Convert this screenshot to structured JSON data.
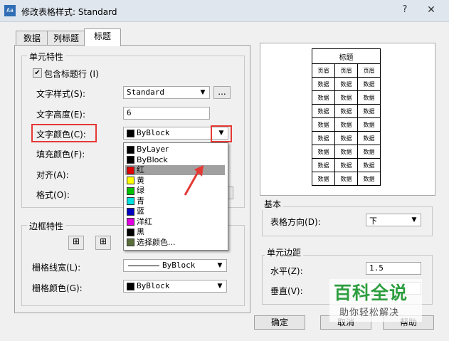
{
  "window": {
    "title": "修改表格样式: Standard",
    "help_glyph": "?",
    "close_glyph": "✕",
    "app_icon": "table-style-icon"
  },
  "tabs": [
    "数据",
    "列标题",
    "标题"
  ],
  "cell_props": {
    "group_title": "单元特性",
    "include_title_row": "包含标题行",
    "include_title_row_key": "(I)",
    "text_style_label": "文字样式",
    "text_style_key": "(S):",
    "text_style_value": "Standard",
    "browse_label": "...",
    "text_height_label": "文字高度",
    "text_height_key": "(E):",
    "text_height_value": "6",
    "text_color_label": "文字颜色",
    "text_color_key": "(C):",
    "text_color_value": "ByBlock",
    "fill_color_label": "填充颜色",
    "fill_color_key": "(F):",
    "align_label": "对齐",
    "align_key": "(A):",
    "format_label": "格式",
    "format_key": "(O):"
  },
  "color_dropdown": {
    "items": [
      {
        "label": "ByLayer",
        "color": "#000000"
      },
      {
        "label": "ByBlock",
        "color": "#000000"
      },
      {
        "label": "红",
        "color": "#e00000"
      },
      {
        "label": "黄",
        "color": "#ffff00"
      },
      {
        "label": "绿",
        "color": "#00c000"
      },
      {
        "label": "青",
        "color": "#00e0e0"
      },
      {
        "label": "蓝",
        "color": "#0000c0"
      },
      {
        "label": "洋红",
        "color": "#e000e0"
      },
      {
        "label": "黑",
        "color": "#000000"
      },
      {
        "label": "选择颜色...",
        "color": "#5a6e3c"
      }
    ],
    "selected_index": 2
  },
  "border_props": {
    "group_title": "边框特性",
    "line_weight_label": "栅格线宽",
    "line_weight_key": "(L):",
    "line_weight_value": "ByBlock",
    "grid_color_label": "栅格颜色",
    "grid_color_key": "(G):",
    "grid_color_value": "ByBlock"
  },
  "preview": {
    "title": "标题",
    "header": [
      "页眉",
      "页眉",
      "页眉"
    ],
    "cell": "数据",
    "rows": 8
  },
  "basic": {
    "group_title": "基本",
    "direction_label": "表格方向",
    "direction_key": "(D):",
    "direction_value": "下"
  },
  "margins": {
    "group_title": "单元边距",
    "horizontal_label": "水平",
    "horizontal_key": "(Z):",
    "horizontal_value": "1.5",
    "vertical_label": "垂直",
    "vertical_key": "(V):"
  },
  "buttons": {
    "ok": "确定",
    "cancel": "取消",
    "help": "帮助"
  },
  "watermark": {
    "main": "百科全说",
    "sub": "助你轻松解决"
  },
  "colors": {
    "highlight": "#e53935",
    "watermark_green": "#2e9e3f"
  }
}
